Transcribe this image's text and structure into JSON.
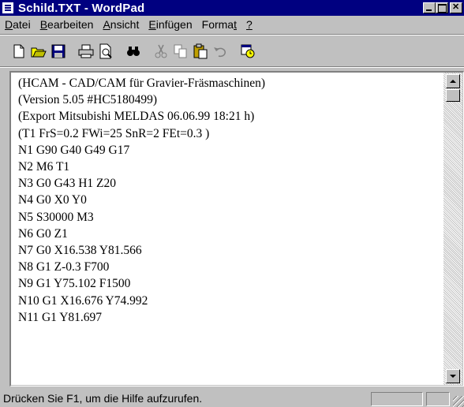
{
  "window": {
    "title": "Schild.TXT - WordPad"
  },
  "menu": {
    "items": [
      {
        "accel": "D",
        "rest": "atei"
      },
      {
        "accel": "B",
        "rest": "earbeiten"
      },
      {
        "accel": "A",
        "rest": "nsicht"
      },
      {
        "accel": "E",
        "rest": "infügen"
      },
      {
        "prefix": "Forma",
        "accel": "t",
        "rest": ""
      },
      {
        "accel": "?",
        "rest": ""
      }
    ]
  },
  "toolbar": {
    "buttons": [
      "new-icon",
      "open-icon",
      "save-icon",
      "print-icon",
      "print-preview-icon",
      "find-icon",
      "cut-icon",
      "copy-icon",
      "paste-icon",
      "undo-icon",
      "date-time-icon"
    ]
  },
  "document": {
    "lines": [
      "(HCAM - CAD/CAM für Gravier-Fräsmaschinen)",
      "(Version 5.05 #HC5180499)",
      "(Export Mitsubishi MELDAS  06.06.99  18:21 h)",
      "(T1 FrS=0.2 FWi=25 SnR=2 FEt=0.3  )",
      "N1 G90 G40 G49 G17",
      "N2 M6 T1",
      "N3 G0 G43 H1 Z20",
      "N4 G0 X0 Y0",
      "N5 S30000 M3",
      "N6 G0 Z1",
      "N7 G0 X16.538 Y81.566",
      "N8 G1 Z-0.3 F700",
      "N9 G1 Y75.102 F1500",
      "N10 G1 X16.676 Y74.992",
      "N11 G1 Y81.697"
    ]
  },
  "status": {
    "text": "Drücken Sie F1, um die Hilfe aufzurufen."
  }
}
